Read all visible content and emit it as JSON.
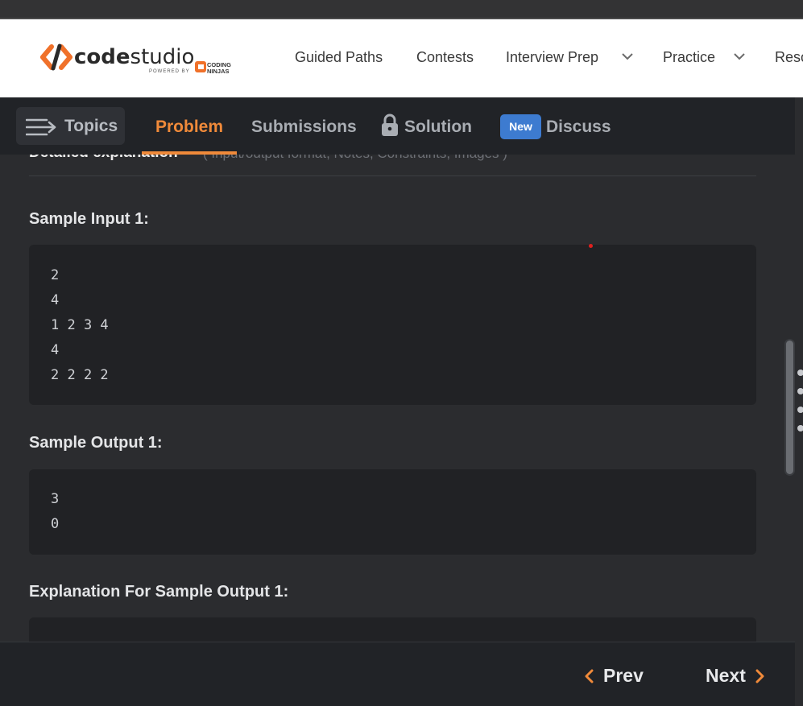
{
  "navbar": {
    "logo_code": "code",
    "logo_studio": "studio",
    "logo_powered": "POWERED BY",
    "logo_coding": "CODING",
    "logo_ninjas": "NINJAS",
    "links": [
      "Guided Paths",
      "Contests",
      "Interview Prep",
      "Practice",
      "Reso"
    ]
  },
  "tabs": {
    "topics": "Topics",
    "problem": "Problem",
    "submissions": "Submissions",
    "solution": "Solution",
    "new_badge": "New",
    "discuss": "Discuss"
  },
  "content": {
    "detail_title": "Detailed explanation",
    "detail_hint": "( Input/output format, Notes, Constraints, Images )",
    "sample_input_title": "Sample Input 1:",
    "sample_input_lines": [
      "2",
      "4",
      "1 2 3 4",
      "4",
      "2 2 2 2"
    ],
    "sample_output_title": "Sample Output 1:",
    "sample_output_lines": [
      "3",
      "0"
    ],
    "explanation_title": "Explanation For Sample Output 1:"
  },
  "footer": {
    "prev": "Prev",
    "next": "Next"
  },
  "colors": {
    "accent": "#f08a3a",
    "badge": "#3d7bd0",
    "background": "#2b2c2f",
    "bar": "#212327"
  }
}
